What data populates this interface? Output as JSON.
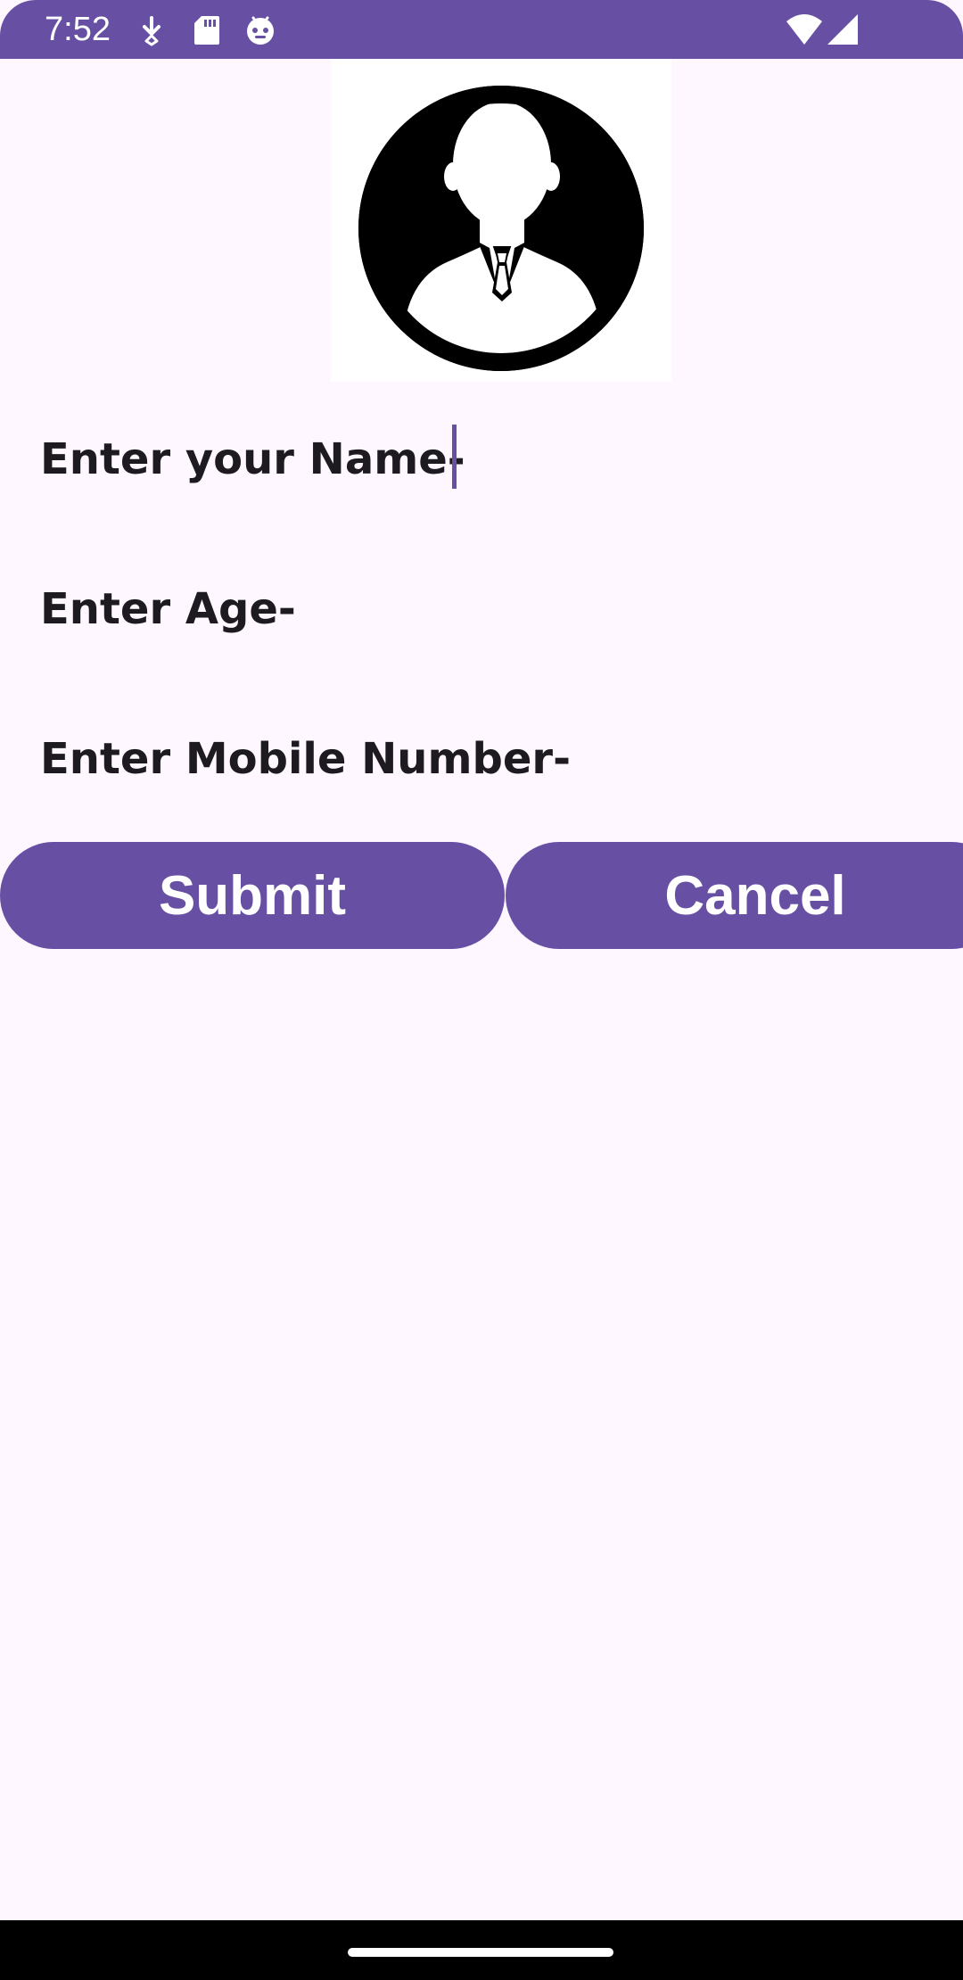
{
  "status_bar": {
    "time": "7:52",
    "left_icons": [
      "download-icon",
      "sd-card-icon",
      "robot-face-icon"
    ],
    "right_icons": [
      "wifi-icon",
      "cell-signal-icon"
    ],
    "color": "#6750A4"
  },
  "profile": {
    "avatar_icon": "person-avatar-icon"
  },
  "form": {
    "name_placeholder": "Enter your Name-",
    "age_placeholder": "Enter Age-",
    "mobile_placeholder": "Enter Mobile Number-"
  },
  "buttons": {
    "submit_label": "Submit",
    "cancel_label": "Cancel",
    "accent": "#6750A4"
  },
  "colors": {
    "background": "#FEF7FF",
    "text": "#1D1B20"
  }
}
